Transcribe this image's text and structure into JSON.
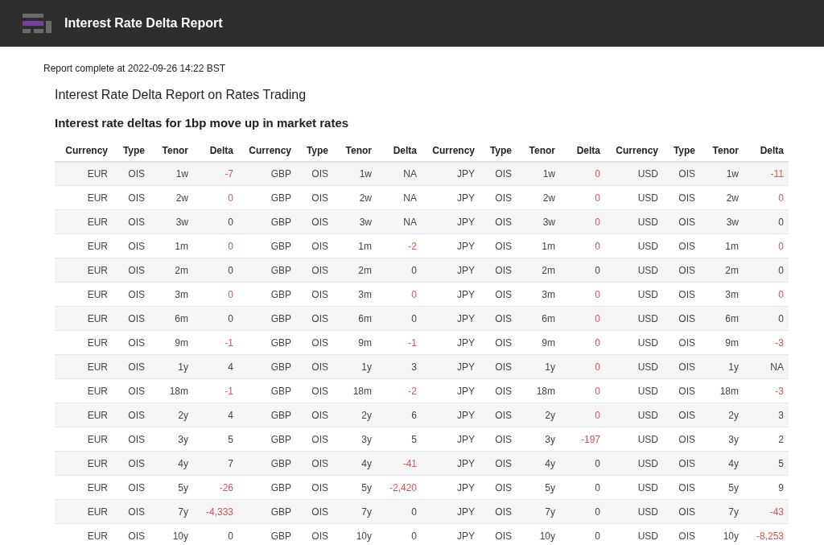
{
  "app_bar": {
    "title": "Interest Rate Delta Report"
  },
  "status": "Report complete at 2022-09-26 14:22 BST",
  "report_title": "Interest Rate Delta Report on Rates Trading",
  "table": {
    "caption": "Interest rate deltas for 1bp move up in market rates",
    "columns": [
      "Currency",
      "Type",
      "Tenor",
      "Delta",
      "Currency",
      "Type",
      "Tenor",
      "Delta",
      "Currency",
      "Type",
      "Tenor",
      "Delta",
      "Currency",
      "Type",
      "Tenor",
      "Delta"
    ],
    "rows": [
      {
        "groups": [
          {
            "currency": "EUR",
            "type": "OIS",
            "tenor": "1w",
            "delta": "-7",
            "negative": true
          },
          {
            "currency": "GBP",
            "type": "OIS",
            "tenor": "1w",
            "delta": "NA",
            "negative": false
          },
          {
            "currency": "JPY",
            "type": "OIS",
            "tenor": "1w",
            "delta": "0",
            "negative": true
          },
          {
            "currency": "USD",
            "type": "OIS",
            "tenor": "1w",
            "delta": "-11",
            "negative": true
          }
        ]
      },
      {
        "groups": [
          {
            "currency": "EUR",
            "type": "OIS",
            "tenor": "2w",
            "delta": "0",
            "negative": true
          },
          {
            "currency": "GBP",
            "type": "OIS",
            "tenor": "2w",
            "delta": "NA",
            "negative": false
          },
          {
            "currency": "JPY",
            "type": "OIS",
            "tenor": "2w",
            "delta": "0",
            "negative": true
          },
          {
            "currency": "USD",
            "type": "OIS",
            "tenor": "2w",
            "delta": "0",
            "negative": true
          }
        ]
      },
      {
        "groups": [
          {
            "currency": "EUR",
            "type": "OIS",
            "tenor": "3w",
            "delta": "0",
            "negative": false
          },
          {
            "currency": "GBP",
            "type": "OIS",
            "tenor": "3w",
            "delta": "NA",
            "negative": false
          },
          {
            "currency": "JPY",
            "type": "OIS",
            "tenor": "3w",
            "delta": "0",
            "negative": true
          },
          {
            "currency": "USD",
            "type": "OIS",
            "tenor": "3w",
            "delta": "0",
            "negative": false
          }
        ]
      },
      {
        "groups": [
          {
            "currency": "EUR",
            "type": "OIS",
            "tenor": "1m",
            "delta": "0",
            "negative": true
          },
          {
            "currency": "GBP",
            "type": "OIS",
            "tenor": "1m",
            "delta": "-2",
            "negative": true
          },
          {
            "currency": "JPY",
            "type": "OIS",
            "tenor": "1m",
            "delta": "0",
            "negative": true
          },
          {
            "currency": "USD",
            "type": "OIS",
            "tenor": "1m",
            "delta": "0",
            "negative": true
          }
        ]
      },
      {
        "groups": [
          {
            "currency": "EUR",
            "type": "OIS",
            "tenor": "2m",
            "delta": "0",
            "negative": false
          },
          {
            "currency": "GBP",
            "type": "OIS",
            "tenor": "2m",
            "delta": "0",
            "negative": false
          },
          {
            "currency": "JPY",
            "type": "OIS",
            "tenor": "2m",
            "delta": "0",
            "negative": false
          },
          {
            "currency": "USD",
            "type": "OIS",
            "tenor": "2m",
            "delta": "0",
            "negative": false
          }
        ]
      },
      {
        "groups": [
          {
            "currency": "EUR",
            "type": "OIS",
            "tenor": "3m",
            "delta": "0",
            "negative": true
          },
          {
            "currency": "GBP",
            "type": "OIS",
            "tenor": "3m",
            "delta": "0",
            "negative": true
          },
          {
            "currency": "JPY",
            "type": "OIS",
            "tenor": "3m",
            "delta": "0",
            "negative": true
          },
          {
            "currency": "USD",
            "type": "OIS",
            "tenor": "3m",
            "delta": "0",
            "negative": true
          }
        ]
      },
      {
        "groups": [
          {
            "currency": "EUR",
            "type": "OIS",
            "tenor": "6m",
            "delta": "0",
            "negative": false
          },
          {
            "currency": "GBP",
            "type": "OIS",
            "tenor": "6m",
            "delta": "0",
            "negative": false
          },
          {
            "currency": "JPY",
            "type": "OIS",
            "tenor": "6m",
            "delta": "0",
            "negative": true
          },
          {
            "currency": "USD",
            "type": "OIS",
            "tenor": "6m",
            "delta": "0",
            "negative": false
          }
        ]
      },
      {
        "groups": [
          {
            "currency": "EUR",
            "type": "OIS",
            "tenor": "9m",
            "delta": "-1",
            "negative": true
          },
          {
            "currency": "GBP",
            "type": "OIS",
            "tenor": "9m",
            "delta": "-1",
            "negative": true
          },
          {
            "currency": "JPY",
            "type": "OIS",
            "tenor": "9m",
            "delta": "0",
            "negative": true
          },
          {
            "currency": "USD",
            "type": "OIS",
            "tenor": "9m",
            "delta": "-3",
            "negative": true
          }
        ]
      },
      {
        "groups": [
          {
            "currency": "EUR",
            "type": "OIS",
            "tenor": "1y",
            "delta": "4",
            "negative": false
          },
          {
            "currency": "GBP",
            "type": "OIS",
            "tenor": "1y",
            "delta": "3",
            "negative": false
          },
          {
            "currency": "JPY",
            "type": "OIS",
            "tenor": "1y",
            "delta": "0",
            "negative": true
          },
          {
            "currency": "USD",
            "type": "OIS",
            "tenor": "1y",
            "delta": "NA",
            "negative": false
          }
        ]
      },
      {
        "groups": [
          {
            "currency": "EUR",
            "type": "OIS",
            "tenor": "18m",
            "delta": "-1",
            "negative": true
          },
          {
            "currency": "GBP",
            "type": "OIS",
            "tenor": "18m",
            "delta": "-2",
            "negative": true
          },
          {
            "currency": "JPY",
            "type": "OIS",
            "tenor": "18m",
            "delta": "0",
            "negative": true
          },
          {
            "currency": "USD",
            "type": "OIS",
            "tenor": "18m",
            "delta": "-3",
            "negative": true
          }
        ]
      },
      {
        "groups": [
          {
            "currency": "EUR",
            "type": "OIS",
            "tenor": "2y",
            "delta": "4",
            "negative": false
          },
          {
            "currency": "GBP",
            "type": "OIS",
            "tenor": "2y",
            "delta": "6",
            "negative": false
          },
          {
            "currency": "JPY",
            "type": "OIS",
            "tenor": "2y",
            "delta": "0",
            "negative": true
          },
          {
            "currency": "USD",
            "type": "OIS",
            "tenor": "2y",
            "delta": "3",
            "negative": false
          }
        ]
      },
      {
        "groups": [
          {
            "currency": "EUR",
            "type": "OIS",
            "tenor": "3y",
            "delta": "5",
            "negative": false
          },
          {
            "currency": "GBP",
            "type": "OIS",
            "tenor": "3y",
            "delta": "5",
            "negative": false
          },
          {
            "currency": "JPY",
            "type": "OIS",
            "tenor": "3y",
            "delta": "-197",
            "negative": true
          },
          {
            "currency": "USD",
            "type": "OIS",
            "tenor": "3y",
            "delta": "2",
            "negative": false
          }
        ]
      },
      {
        "groups": [
          {
            "currency": "EUR",
            "type": "OIS",
            "tenor": "4y",
            "delta": "7",
            "negative": false
          },
          {
            "currency": "GBP",
            "type": "OIS",
            "tenor": "4y",
            "delta": "-41",
            "negative": true
          },
          {
            "currency": "JPY",
            "type": "OIS",
            "tenor": "4y",
            "delta": "0",
            "negative": false
          },
          {
            "currency": "USD",
            "type": "OIS",
            "tenor": "4y",
            "delta": "5",
            "negative": false
          }
        ]
      },
      {
        "groups": [
          {
            "currency": "EUR",
            "type": "OIS",
            "tenor": "5y",
            "delta": "-26",
            "negative": true
          },
          {
            "currency": "GBP",
            "type": "OIS",
            "tenor": "5y",
            "delta": "-2,420",
            "negative": true
          },
          {
            "currency": "JPY",
            "type": "OIS",
            "tenor": "5y",
            "delta": "0",
            "negative": false
          },
          {
            "currency": "USD",
            "type": "OIS",
            "tenor": "5y",
            "delta": "9",
            "negative": false
          }
        ]
      },
      {
        "groups": [
          {
            "currency": "EUR",
            "type": "OIS",
            "tenor": "7y",
            "delta": "-4,333",
            "negative": true
          },
          {
            "currency": "GBP",
            "type": "OIS",
            "tenor": "7y",
            "delta": "0",
            "negative": false
          },
          {
            "currency": "JPY",
            "type": "OIS",
            "tenor": "7y",
            "delta": "0",
            "negative": false
          },
          {
            "currency": "USD",
            "type": "OIS",
            "tenor": "7y",
            "delta": "-43",
            "negative": true
          }
        ]
      },
      {
        "groups": [
          {
            "currency": "EUR",
            "type": "OIS",
            "tenor": "10y",
            "delta": "0",
            "negative": false
          },
          {
            "currency": "GBP",
            "type": "OIS",
            "tenor": "10y",
            "delta": "0",
            "negative": false
          },
          {
            "currency": "JPY",
            "type": "OIS",
            "tenor": "10y",
            "delta": "0",
            "negative": false
          },
          {
            "currency": "USD",
            "type": "OIS",
            "tenor": "10y",
            "delta": "-8,253",
            "negative": true
          }
        ]
      }
    ]
  }
}
